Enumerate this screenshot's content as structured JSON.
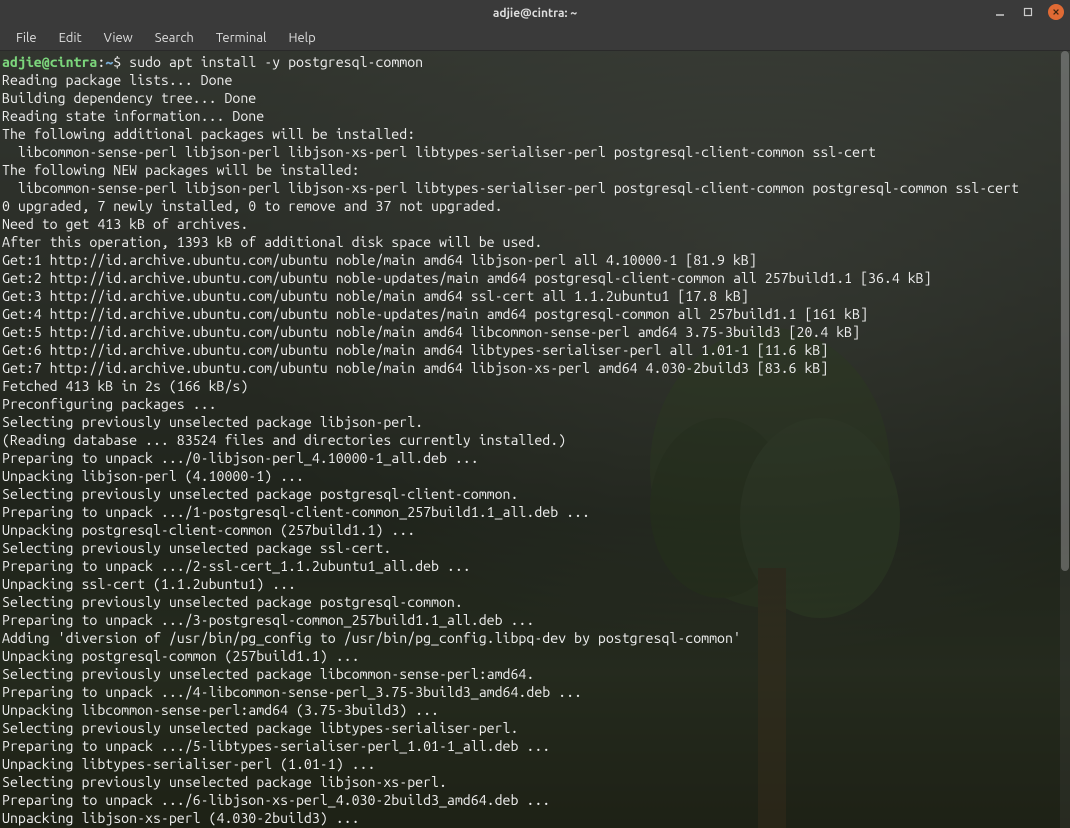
{
  "window": {
    "title": "adjie@cintra: ~"
  },
  "menubar": {
    "items": [
      "File",
      "Edit",
      "View",
      "Search",
      "Terminal",
      "Help"
    ]
  },
  "prompt": {
    "user": "adjie",
    "at": "@",
    "host": "cintra",
    "colon": ":",
    "path": "~",
    "dollar": "$"
  },
  "command": " sudo apt install -y postgresql-common",
  "output_lines": [
    "Reading package lists... Done",
    "Building dependency tree... Done",
    "Reading state information... Done",
    "The following additional packages will be installed:",
    "  libcommon-sense-perl libjson-perl libjson-xs-perl libtypes-serialiser-perl postgresql-client-common ssl-cert",
    "The following NEW packages will be installed:",
    "  libcommon-sense-perl libjson-perl libjson-xs-perl libtypes-serialiser-perl postgresql-client-common postgresql-common ssl-cert",
    "0 upgraded, 7 newly installed, 0 to remove and 37 not upgraded.",
    "Need to get 413 kB of archives.",
    "After this operation, 1393 kB of additional disk space will be used.",
    "Get:1 http://id.archive.ubuntu.com/ubuntu noble/main amd64 libjson-perl all 4.10000-1 [81.9 kB]",
    "Get:2 http://id.archive.ubuntu.com/ubuntu noble-updates/main amd64 postgresql-client-common all 257build1.1 [36.4 kB]",
    "Get:3 http://id.archive.ubuntu.com/ubuntu noble/main amd64 ssl-cert all 1.1.2ubuntu1 [17.8 kB]",
    "Get:4 http://id.archive.ubuntu.com/ubuntu noble-updates/main amd64 postgresql-common all 257build1.1 [161 kB]",
    "Get:5 http://id.archive.ubuntu.com/ubuntu noble/main amd64 libcommon-sense-perl amd64 3.75-3build3 [20.4 kB]",
    "Get:6 http://id.archive.ubuntu.com/ubuntu noble/main amd64 libtypes-serialiser-perl all 1.01-1 [11.6 kB]",
    "Get:7 http://id.archive.ubuntu.com/ubuntu noble/main amd64 libjson-xs-perl amd64 4.030-2build3 [83.6 kB]",
    "Fetched 413 kB in 2s (166 kB/s)",
    "Preconfiguring packages ...",
    "Selecting previously unselected package libjson-perl.",
    "(Reading database ... 83524 files and directories currently installed.)",
    "Preparing to unpack .../0-libjson-perl_4.10000-1_all.deb ...",
    "Unpacking libjson-perl (4.10000-1) ...",
    "Selecting previously unselected package postgresql-client-common.",
    "Preparing to unpack .../1-postgresql-client-common_257build1.1_all.deb ...",
    "Unpacking postgresql-client-common (257build1.1) ...",
    "Selecting previously unselected package ssl-cert.",
    "Preparing to unpack .../2-ssl-cert_1.1.2ubuntu1_all.deb ...",
    "Unpacking ssl-cert (1.1.2ubuntu1) ...",
    "Selecting previously unselected package postgresql-common.",
    "Preparing to unpack .../3-postgresql-common_257build1.1_all.deb ...",
    "Adding 'diversion of /usr/bin/pg_config to /usr/bin/pg_config.libpq-dev by postgresql-common'",
    "Unpacking postgresql-common (257build1.1) ...",
    "Selecting previously unselected package libcommon-sense-perl:amd64.",
    "Preparing to unpack .../4-libcommon-sense-perl_3.75-3build3_amd64.deb ...",
    "Unpacking libcommon-sense-perl:amd64 (3.75-3build3) ...",
    "Selecting previously unselected package libtypes-serialiser-perl.",
    "Preparing to unpack .../5-libtypes-serialiser-perl_1.01-1_all.deb ...",
    "Unpacking libtypes-serialiser-perl (1.01-1) ...",
    "Selecting previously unselected package libjson-xs-perl.",
    "Preparing to unpack .../6-libjson-xs-perl_4.030-2build3_amd64.deb ...",
    "Unpacking libjson-xs-perl (4.030-2build3) ..."
  ]
}
